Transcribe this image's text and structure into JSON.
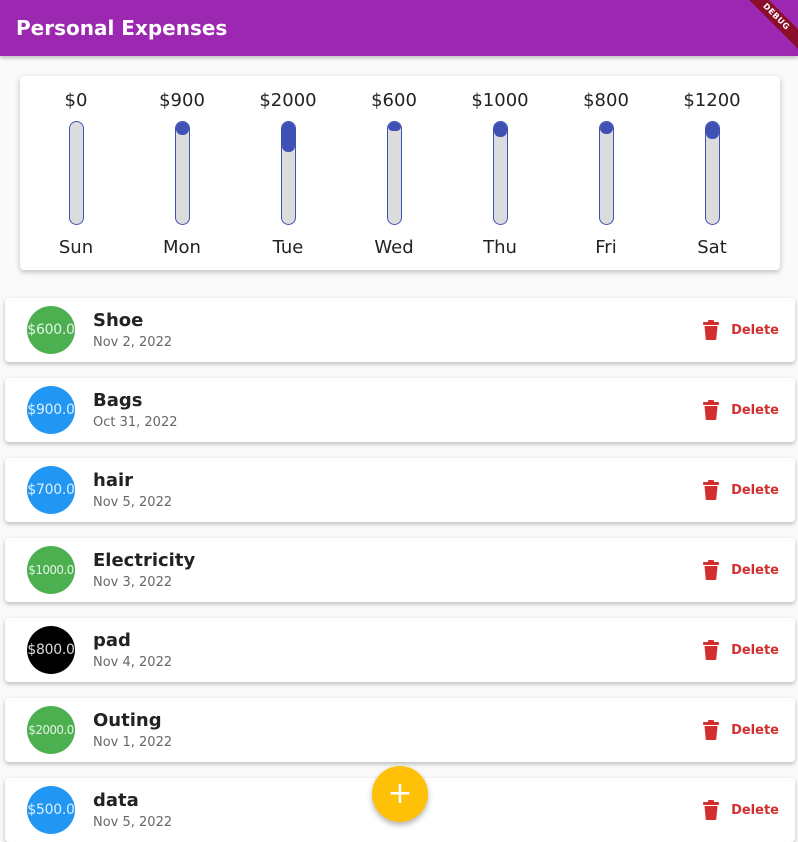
{
  "appbar": {
    "title": "Personal Expenses",
    "debug_banner": "DEBUG"
  },
  "colors": {
    "appbar": "#9c27b0",
    "bar_fill": "#3f51b5",
    "bar_track": "#dcdcdc",
    "delete": "#d32f2f",
    "fab": "#ffc107",
    "green": "#4caf50",
    "blue": "#2196f3",
    "black": "#000000"
  },
  "chart_data": {
    "type": "bar",
    "categories": [
      "Sun",
      "Mon",
      "Tue",
      "Wed",
      "Thu",
      "Fri",
      "Sat"
    ],
    "amount_labels": [
      "$0",
      "$900",
      "$2000",
      "$600",
      "$1000",
      "$800",
      "$1200"
    ],
    "values": [
      0,
      900,
      2000,
      600,
      1000,
      800,
      1200
    ],
    "fill_fraction": [
      0.0,
      0.13,
      0.29,
      0.09,
      0.15,
      0.12,
      0.17
    ]
  },
  "transactions": [
    {
      "amount": "$600.0",
      "title": "Shoe",
      "date": "Nov 2, 2022",
      "color": "green"
    },
    {
      "amount": "$900.0",
      "title": "Bags",
      "date": "Oct 31, 2022",
      "color": "blue"
    },
    {
      "amount": "$700.0",
      "title": "hair",
      "date": "Nov 5, 2022",
      "color": "blue"
    },
    {
      "amount": "$1000.0",
      "title": "Electricity",
      "date": "Nov 3, 2022",
      "color": "green"
    },
    {
      "amount": "$800.0",
      "title": "pad",
      "date": "Nov 4, 2022",
      "color": "black"
    },
    {
      "amount": "$2000.0",
      "title": "Outing",
      "date": "Nov 1, 2022",
      "color": "green"
    },
    {
      "amount": "$500.0",
      "title": "data",
      "date": "Nov 5, 2022",
      "color": "blue"
    }
  ],
  "delete_label": "Delete",
  "delete_icon": "trash-icon",
  "fab": {
    "label": "+",
    "icon": "add-icon"
  }
}
